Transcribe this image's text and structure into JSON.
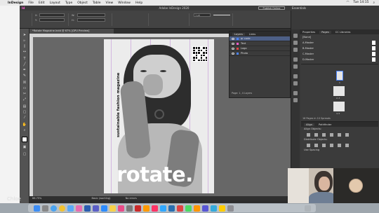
{
  "menubar": {
    "app": "InDesign",
    "items": [
      "File",
      "Edit",
      "Layout",
      "Type",
      "Object",
      "Table",
      "View",
      "Window",
      "Help"
    ],
    "clock": "Tue 14:15"
  },
  "appbar": {
    "title": "Adobe InDesign 2020",
    "publish": "Publish Online",
    "workspace": "Essentials"
  },
  "control": {
    "stroke_weight": "1 pt"
  },
  "document_tab": "*Rotate Magazine.indd @ 67% [GPU Preview]",
  "page": {
    "vertical_text": "sustainable fashion magazine",
    "headline": "rotate."
  },
  "layers_panel": {
    "tabs": [
      "Layers",
      "Links"
    ],
    "rows": [
      {
        "label": "qr code",
        "color": "#4a84ff",
        "selected": true
      },
      {
        "label": "Text",
        "color": "#ff5bd1",
        "selected": false
      },
      {
        "label": "Logo",
        "color": "#e04343",
        "selected": false
      },
      {
        "label": "Photo",
        "color": "#4a84ff",
        "selected": false
      }
    ],
    "footer": "Page: 1, 4 Layers"
  },
  "right_panel": {
    "tabs": [
      "Properties",
      "Pages",
      "CC Libraries"
    ],
    "masters": [
      "[None]",
      "A-Master",
      "B-Master",
      "C-Master",
      "D-Master"
    ],
    "page_labels": [
      "1",
      "2–3",
      "4–5"
    ],
    "pages_footer": "16 Pages in 10 Spreads",
    "align_tabs": [
      "Align",
      "Pathfinder"
    ],
    "align_sections": [
      "Align Objects:",
      "Distribute Objects:",
      "Use Spacing"
    ]
  },
  "statusbar": {
    "zoom": "66.75%",
    "status": "Basic (working)",
    "errors": "No errors"
  },
  "participant_name": "Chloe"
}
